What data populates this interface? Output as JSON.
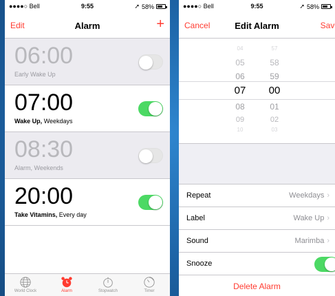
{
  "left": {
    "status": {
      "carrier": "●●●●○ Bell",
      "time": "9:55",
      "battery": "58%"
    },
    "nav": {
      "left": "Edit",
      "title": "Alarm",
      "right": "+"
    },
    "alarms": [
      {
        "time": "06:00",
        "label_bold": "Early Wake Up",
        "label_rest": "",
        "on": false
      },
      {
        "time": "07:00",
        "label_bold": "Wake Up,",
        "label_rest": " Weekdays",
        "on": true
      },
      {
        "time": "08:30",
        "label_bold": "Alarm,",
        "label_rest": " Weekends",
        "on": false
      },
      {
        "time": "20:00",
        "label_bold": "Take Vitamins,",
        "label_rest": " Every day",
        "on": true
      }
    ],
    "tabs": [
      {
        "label": "World Clock",
        "icon": "globe-icon",
        "active": false
      },
      {
        "label": "Alarm",
        "icon": "alarm-clock-icon",
        "active": true
      },
      {
        "label": "Stopwatch",
        "icon": "stopwatch-icon",
        "active": false
      },
      {
        "label": "Timer",
        "icon": "timer-icon",
        "active": false
      }
    ]
  },
  "right": {
    "status": {
      "carrier": "●●●●○ Bell",
      "time": "9:55",
      "battery": "58%"
    },
    "nav": {
      "left": "Cancel",
      "title": "Edit Alarm",
      "right": "Save"
    },
    "picker": {
      "hours": [
        "04",
        "05",
        "06",
        "07",
        "08",
        "09",
        "10"
      ],
      "minutes": [
        "57",
        "58",
        "59",
        "00",
        "01",
        "02",
        "03"
      ],
      "selected_hour": "07",
      "selected_minute": "00"
    },
    "rows": {
      "repeat": {
        "label": "Repeat",
        "value": "Weekdays"
      },
      "label": {
        "label": "Label",
        "value": "Wake Up"
      },
      "sound": {
        "label": "Sound",
        "value": "Marimba"
      },
      "snooze": {
        "label": "Snooze",
        "on": true
      }
    },
    "delete_label": "Delete Alarm"
  },
  "colors": {
    "accent": "#ff3b30",
    "toggle_on": "#4cd964",
    "background": "#1d63a5"
  }
}
